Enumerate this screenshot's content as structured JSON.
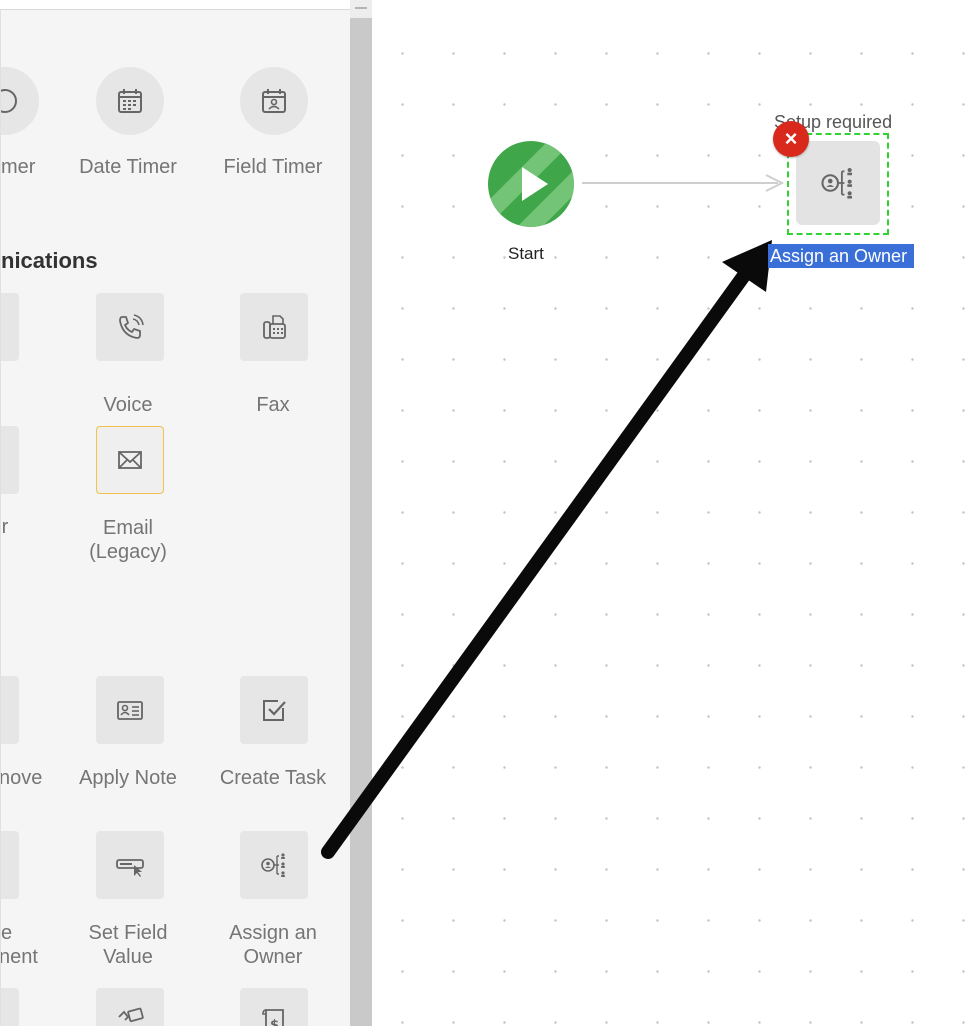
{
  "palette": {
    "timers": [
      {
        "label": "mer"
      },
      {
        "label": "Date Timer"
      },
      {
        "label": "Field Timer"
      }
    ],
    "section_heading": "nications",
    "communications": [
      {
        "label": "Voice"
      },
      {
        "label": "Fax"
      },
      {
        "label": "Email"
      },
      {
        "label": "(Legacy)"
      }
    ],
    "actions_row1": [
      {
        "label": "nove"
      },
      {
        "label": "Apply Note"
      },
      {
        "label": "Create Task"
      }
    ],
    "actions_row2": [
      {
        "label_line1": "e",
        "label_line2": "nent"
      },
      {
        "label_line1": "Set Field",
        "label_line2": "Value"
      },
      {
        "label_line1": "Assign an",
        "label_line2": "Owner"
      }
    ]
  },
  "canvas": {
    "start_node": {
      "label": "Start",
      "color": "#3fa64a"
    },
    "owner_node": {
      "status": "Setup required",
      "label": "Assign an Owner",
      "error_glyph": "×",
      "error_color": "#d9291c",
      "selection_color": "#3a6fd8"
    }
  },
  "colors": {
    "tile": "#e6e6e6",
    "selected_tile_border": "#f2c14e",
    "panel": "#f5f5f5",
    "scrollbar": "#c9c9c9"
  }
}
